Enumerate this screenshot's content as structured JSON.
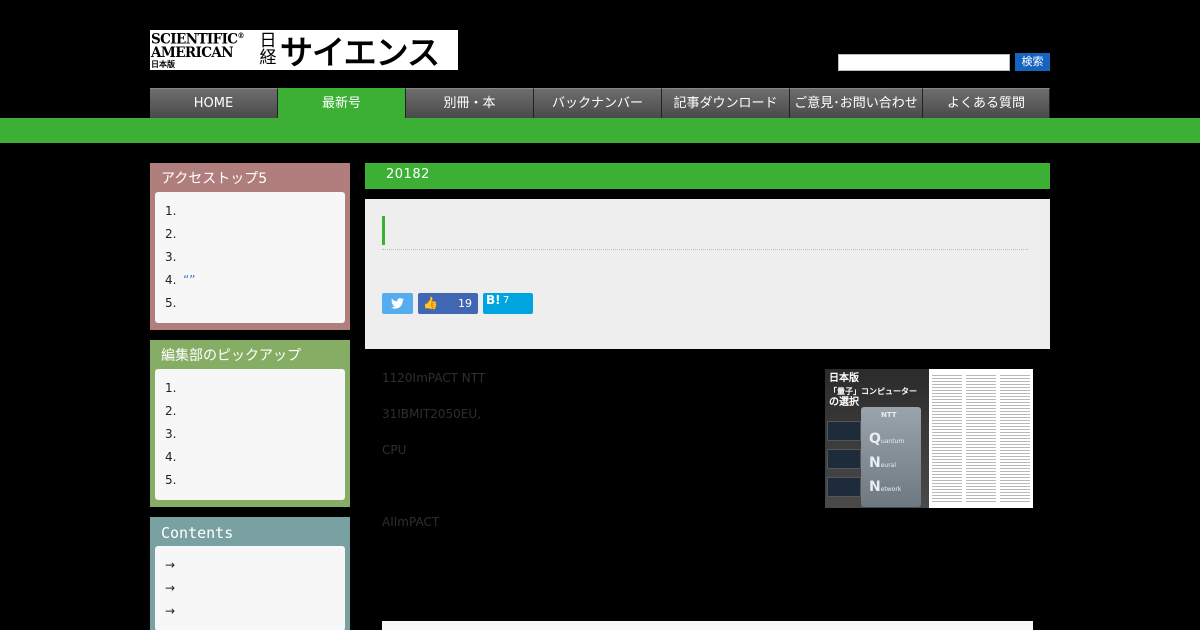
{
  "header": {
    "logo": {
      "line1": "SCIENTIFIC",
      "reg": "®",
      "line2": "AMERICAN",
      "line3": "日本版",
      "small_jp": "日経",
      "big_jp": "サイエンス"
    },
    "search": {
      "placeholder": "",
      "button_label": "検索"
    }
  },
  "nav": {
    "items": [
      "HOME",
      "最新号",
      "別冊・本",
      "バックナンバー",
      "記事ダウンロード",
      "ご意見･お問い合わせ",
      "よくある質問"
    ],
    "active_index": 1
  },
  "sidebar": {
    "access_top5": {
      "title": "アクセストップ5",
      "items": [
        {
          "num": "1.",
          "text": ""
        },
        {
          "num": "2.",
          "text": ""
        },
        {
          "num": "3.",
          "text": ""
        },
        {
          "num": "4.",
          "text": "“”"
        },
        {
          "num": "5.",
          "text": ""
        }
      ]
    },
    "editors_pickup": {
      "title": "編集部のピックアップ",
      "items": [
        {
          "num": "1.",
          "text": ""
        },
        {
          "num": "2.",
          "text": ""
        },
        {
          "num": "3.",
          "text": ""
        },
        {
          "num": "4.",
          "text": ""
        },
        {
          "num": "5.",
          "text": ""
        }
      ]
    },
    "contents": {
      "title": "Contents",
      "items": [
        "",
        "",
        ""
      ]
    }
  },
  "main": {
    "issue_header": "20182",
    "share": {
      "facebook_count": "19",
      "hatena_label": "B!",
      "hatena_count": "7"
    },
    "paragraphs": [
      "1120ImPACT NTT",
      "31IBMIT2050EU,",
      "CPU",
      "AIImPACT"
    ],
    "image": {
      "title_lines": [
        "日本版",
        "「量子」コンピューター",
        "の選択"
      ],
      "device_letters": [
        {
          "letter": "Q",
          "word": "uantum"
        },
        {
          "letter": "N",
          "word": "eural"
        },
        {
          "letter": "N",
          "word": "etwork"
        }
      ],
      "device_badge": "NTT"
    }
  },
  "colors": {
    "accent_green": "#3cb035",
    "search_blue": "#1565c0"
  }
}
